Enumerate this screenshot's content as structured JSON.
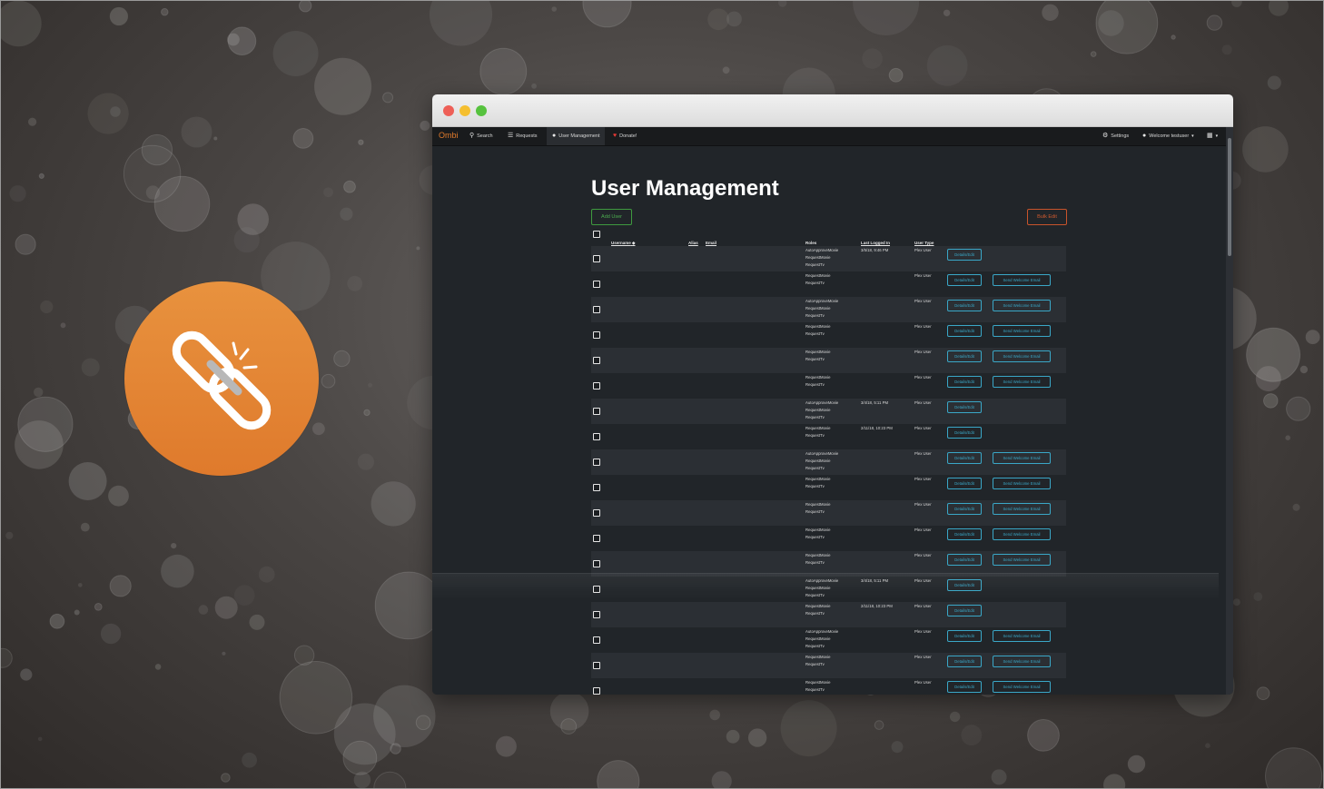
{
  "app": {
    "brand": "Ombi",
    "nav": {
      "search": "Search",
      "requests": "Requests",
      "user_management": "User Management",
      "donate": "Donate!",
      "settings": "Settings",
      "welcome": "Welcome testuser",
      "icon_names": [
        "search-icon",
        "list-icon",
        "user-icon",
        "heart-icon",
        "gear-icon",
        "user-icon",
        "language-icon"
      ]
    }
  },
  "page": {
    "title": "User Management",
    "add_user": "Add User",
    "bulk_edit": "Bulk Edit"
  },
  "table": {
    "headers": {
      "username": "Username",
      "alias": "Alias",
      "email": "Email",
      "roles": "Roles",
      "last_logged_in": "Last Logged In",
      "user_type": "User Type"
    },
    "rows": [
      {
        "roles": [
          "AutoApproveMovie",
          "RequestMovie",
          "RequestTv"
        ],
        "last": "3/5/18, 9:46 PM",
        "type": "Plex User",
        "welcome": false
      },
      {
        "roles": [
          "RequestMovie",
          "RequestTv"
        ],
        "last": "",
        "type": "Plex User",
        "welcome": true
      },
      {
        "roles": [
          "AutoApproveMovie",
          "RequestMovie",
          "RequestTv"
        ],
        "last": "",
        "type": "Plex User",
        "welcome": true
      },
      {
        "roles": [
          "RequestMovie",
          "RequestTv"
        ],
        "last": "",
        "type": "Plex User",
        "welcome": true
      },
      {
        "roles": [
          "RequestMovie",
          "RequestTv"
        ],
        "last": "",
        "type": "Plex User",
        "welcome": true
      },
      {
        "roles": [
          "RequestMovie",
          "RequestTv"
        ],
        "last": "",
        "type": "Plex User",
        "welcome": true
      },
      {
        "roles": [
          "AutoApproveMovie",
          "RequestMovie",
          "RequestTv"
        ],
        "last": "3/4/18, 5:11 PM",
        "type": "Plex User",
        "welcome": false
      },
      {
        "roles": [
          "RequestMovie",
          "RequestTv"
        ],
        "last": "2/11/18, 10:23 PM",
        "type": "Plex User",
        "welcome": false
      },
      {
        "roles": [
          "AutoApproveMovie",
          "RequestMovie",
          "RequestTv"
        ],
        "last": "",
        "type": "Plex User",
        "welcome": true
      },
      {
        "roles": [
          "RequestMovie",
          "RequestTv"
        ],
        "last": "",
        "type": "Plex User",
        "welcome": true
      },
      {
        "roles": [
          "RequestMovie",
          "RequestTv"
        ],
        "last": "",
        "type": "Plex User",
        "welcome": true
      },
      {
        "roles": [
          "RequestMovie",
          "RequestTv"
        ],
        "last": "",
        "type": "Plex User",
        "welcome": true
      },
      {
        "roles": [
          "RequestMovie",
          "RequestTv"
        ],
        "last": "",
        "type": "Plex User",
        "welcome": true
      },
      {
        "roles": [
          "AutoApproveMovie",
          "RequestMovie",
          "RequestTv"
        ],
        "last": "3/4/18, 5:11 PM",
        "type": "Plex User",
        "welcome": false
      },
      {
        "roles": [
          "RequestMovie",
          "RequestTv"
        ],
        "last": "2/11/18, 10:23 PM",
        "type": "Plex User",
        "welcome": false
      },
      {
        "roles": [
          "AutoApproveMovie",
          "RequestMovie",
          "RequestTv"
        ],
        "last": "",
        "type": "Plex User",
        "welcome": true
      },
      {
        "roles": [
          "RequestMovie",
          "RequestTv"
        ],
        "last": "",
        "type": "Plex User",
        "welcome": true
      },
      {
        "roles": [
          "RequestMovie",
          "RequestTv"
        ],
        "last": "",
        "type": "Plex User",
        "welcome": true
      }
    ],
    "details_label": "Details/Edit",
    "welcome_label": "Send Welcome Email"
  },
  "colors": {
    "badge": "#e38834",
    "brand": "#e07a2b",
    "add_user": "#4caf50",
    "bulk_edit": "#d05a2f",
    "row_button": "#3aa7c7"
  },
  "badge_icon": "broken-link-icon"
}
